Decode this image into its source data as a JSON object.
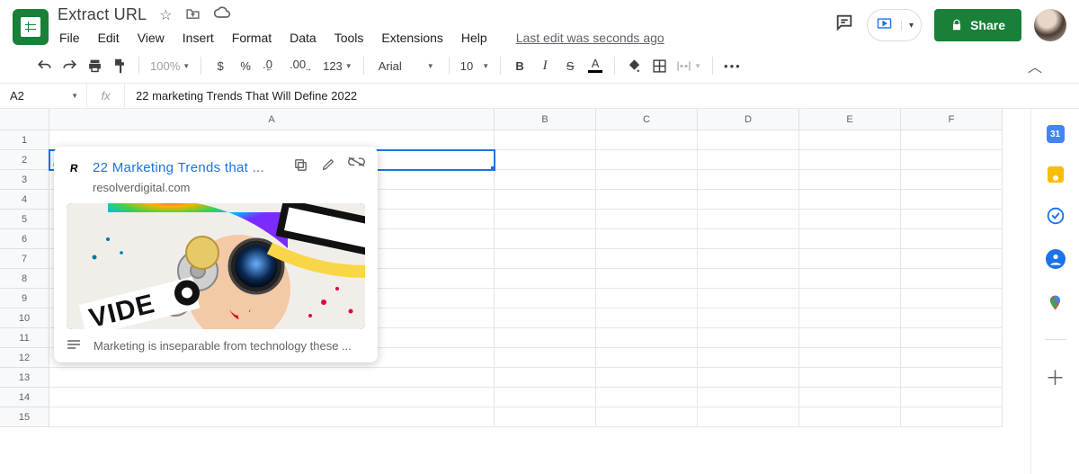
{
  "doc_title": "Extract URL",
  "menus": {
    "file": "File",
    "edit": "Edit",
    "view": "View",
    "insert": "Insert",
    "format": "Format",
    "data": "Data",
    "tools": "Tools",
    "extensions": "Extensions",
    "help": "Help"
  },
  "last_edit": "Last edit was seconds ago",
  "share_label": "Share",
  "toolbar": {
    "zoom": "100%",
    "currency": "$",
    "percent": "%",
    "dec_dec": ".0",
    "dec_inc": ".00",
    "more_fmt": "123",
    "font": "Arial",
    "font_size": "10"
  },
  "name_box": "A2",
  "formula": "22 marketing Trends That Will Define 2022",
  "columns": [
    "A",
    "B",
    "C",
    "D",
    "E",
    "F"
  ],
  "rows": [
    "1",
    "2",
    "3",
    "4",
    "5",
    "6",
    "7",
    "8",
    "9",
    "10",
    "11",
    "12",
    "13",
    "14",
    "15"
  ],
  "cell_a2": "22 marketing Trends That Will Define 2022",
  "link_card": {
    "title": "22 Marketing Trends that ...",
    "domain": "resolverdigital.com",
    "description": "Marketing is inseparable from technology these ..."
  }
}
